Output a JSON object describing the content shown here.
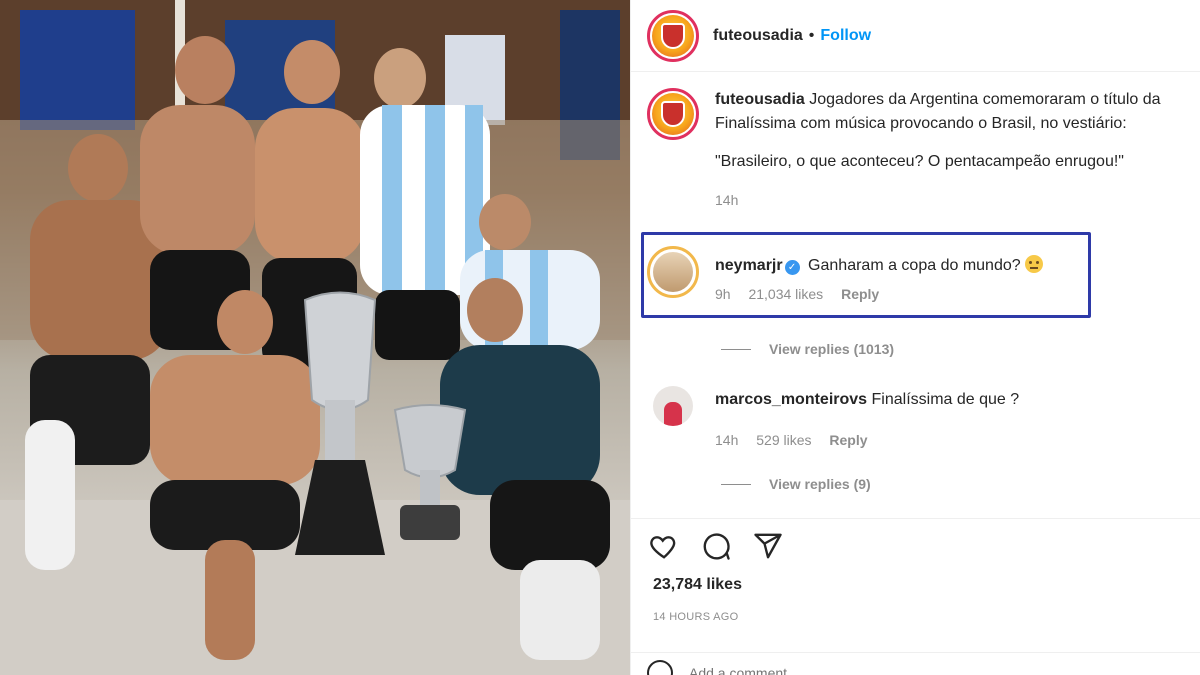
{
  "post": {
    "username": "futeousadia",
    "separator": "•",
    "follow_label": "Follow"
  },
  "caption": {
    "username": "futeousadia",
    "text_line1": "Jogadores da Argentina comemoraram o título da Finalíssima com música provocando o Brasil, no vestiário:",
    "text_line2": "\"Brasileiro, o que aconteceu? O pentacampeão enrugou!\"",
    "time": "14h"
  },
  "comments": [
    {
      "username": "neymarjr",
      "verified": true,
      "text": "Ganharam a copa do mundo?",
      "emoji": "thinking-face",
      "time": "9h",
      "likes": "21,034 likes",
      "reply_label": "Reply",
      "view_replies": "View replies (1013)"
    },
    {
      "username": "marcos_monteirovs",
      "text": "Finalíssima de que ?",
      "time": "14h",
      "likes": "529 likes",
      "reply_label": "Reply",
      "view_replies": "View replies (9)"
    }
  ],
  "actions": {
    "icons": [
      "heart-icon",
      "comment-icon",
      "share-icon"
    ]
  },
  "stats": {
    "likes": "23,784 likes",
    "posted": "14 HOURS AGO"
  },
  "add_comment": {
    "placeholder": "Add a comment..."
  },
  "colors": {
    "follow": "#0095f6",
    "highlight_border": "#2e3aa8",
    "verified": "#3897f0",
    "secondary_text": "#8e8e8e"
  }
}
